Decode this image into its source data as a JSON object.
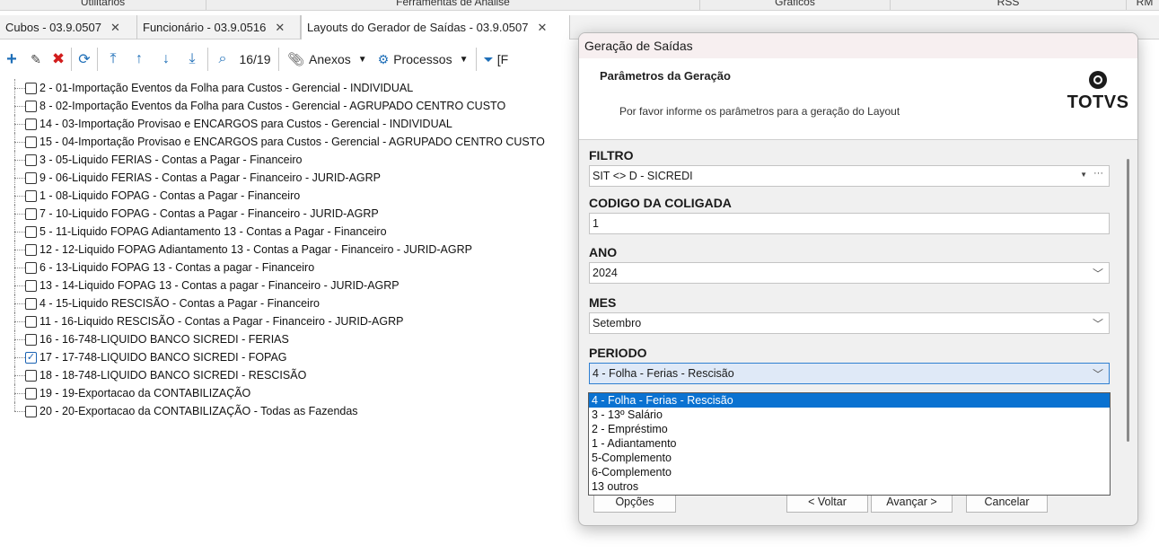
{
  "menubar": {
    "items": [
      "Utilitários",
      "Ferramentas de Análise",
      "Gráficos",
      "RSS",
      "RM"
    ]
  },
  "tabs": [
    {
      "label": "Cubos - 03.9.0507"
    },
    {
      "label": "Funcionário - 03.9.0516"
    },
    {
      "label": "Layouts do Gerador de Saídas - 03.9.0507"
    }
  ],
  "toolbar": {
    "record_counter": "16/19",
    "anexos_label": "Anexos",
    "processos_label": "Processos",
    "filter_label": "[F"
  },
  "tree": {
    "items": [
      {
        "label": "2 - 01-Importação Eventos da Folha para Custos - Gerencial - INDIVIDUAL",
        "checked": false
      },
      {
        "label": "8 - 02-Importação Eventos da Folha para Custos - Gerencial - AGRUPADO CENTRO CUSTO",
        "checked": false
      },
      {
        "label": "14 - 03-Importação Provisao e  ENCARGOS para Custos - Gerencial - INDIVIDUAL",
        "checked": false
      },
      {
        "label": "15 - 04-Importação Provisao e  ENCARGOS para Custos - Gerencial - AGRUPADO CENTRO CUSTO",
        "checked": false
      },
      {
        "label": "3 - 05-Liquido FERIAS - Contas a Pagar - Financeiro",
        "checked": false
      },
      {
        "label": "9 - 06-Liquido FERIAS - Contas a Pagar - Financeiro - JURID-AGRP",
        "checked": false
      },
      {
        "label": "1 - 08-Liquido FOPAG - Contas a Pagar - Financeiro",
        "checked": false
      },
      {
        "label": "7 - 10-Liquido FOPAG - Contas a Pagar - Financeiro - JURID-AGRP",
        "checked": false
      },
      {
        "label": "5 - 11-Liquido FOPAG Adiantamento 13 - Contas a Pagar - Financeiro",
        "checked": false
      },
      {
        "label": "12 - 12-Liquido FOPAG Adiantamento 13 - Contas a Pagar - Financeiro - JURID-AGRP",
        "checked": false
      },
      {
        "label": "6 - 13-Liquido FOPAG 13 - Contas a pagar - Financeiro",
        "checked": false
      },
      {
        "label": "13 - 14-Liquido FOPAG 13 - Contas a pagar - Financeiro - JURID-AGRP",
        "checked": false
      },
      {
        "label": "4 - 15-Liquido RESCISÃO - Contas a Pagar - Financeiro",
        "checked": false
      },
      {
        "label": "11 - 16-Liquido RESCISÃO - Contas a Pagar - Financeiro - JURID-AGRP",
        "checked": false
      },
      {
        "label": "16 - 16-748-LIQUIDO BANCO SICREDI - FERIAS",
        "checked": false
      },
      {
        "label": "17 - 17-748-LIQUIDO BANCO SICREDI - FOPAG",
        "checked": true
      },
      {
        "label": "18 - 18-748-LIQUIDO BANCO SICREDI - RESCISÃO",
        "checked": false
      },
      {
        "label": "19 - 19-Exportacao da CONTABILIZAÇÃO",
        "checked": false
      },
      {
        "label": "20 - 20-Exportacao da CONTABILIZAÇÃO - Todas as Fazendas",
        "checked": false
      }
    ]
  },
  "dialog": {
    "title": "Geração de Saídas",
    "heading": "Parâmetros da Geração",
    "subheading": "Por favor informe os parâmetros para a geração do Layout",
    "logo_text": "TOTVS",
    "fields": {
      "filtro": {
        "label": "FILTRO",
        "value": "SIT <> D - SICREDI"
      },
      "coligada": {
        "label": "CODIGO DA COLIGADA",
        "value": "1"
      },
      "ano": {
        "label": "ANO",
        "value": "2024"
      },
      "mes": {
        "label": "MES",
        "value": "Setembro"
      },
      "periodo": {
        "label": "PERIODO",
        "value": "4 - Folha - Ferias - Rescisão"
      }
    },
    "periodo_options": [
      "4 - Folha - Ferias - Rescisão",
      "3 - 13º Salário",
      "2 - Empréstimo",
      "1 - Adiantamento",
      "5-Complemento",
      "6-Complemento",
      "13 outros"
    ],
    "buttons": {
      "opcoes": "Opções",
      "voltar": "< Voltar",
      "avancar": "Avançar >",
      "cancelar": "Cancelar"
    }
  },
  "colors": {
    "accent_blue": "#1f6fb8",
    "delete_red": "#d21d1d",
    "selection_blue": "#0a72d1",
    "dialog_title_bg": "#f7eff0"
  }
}
